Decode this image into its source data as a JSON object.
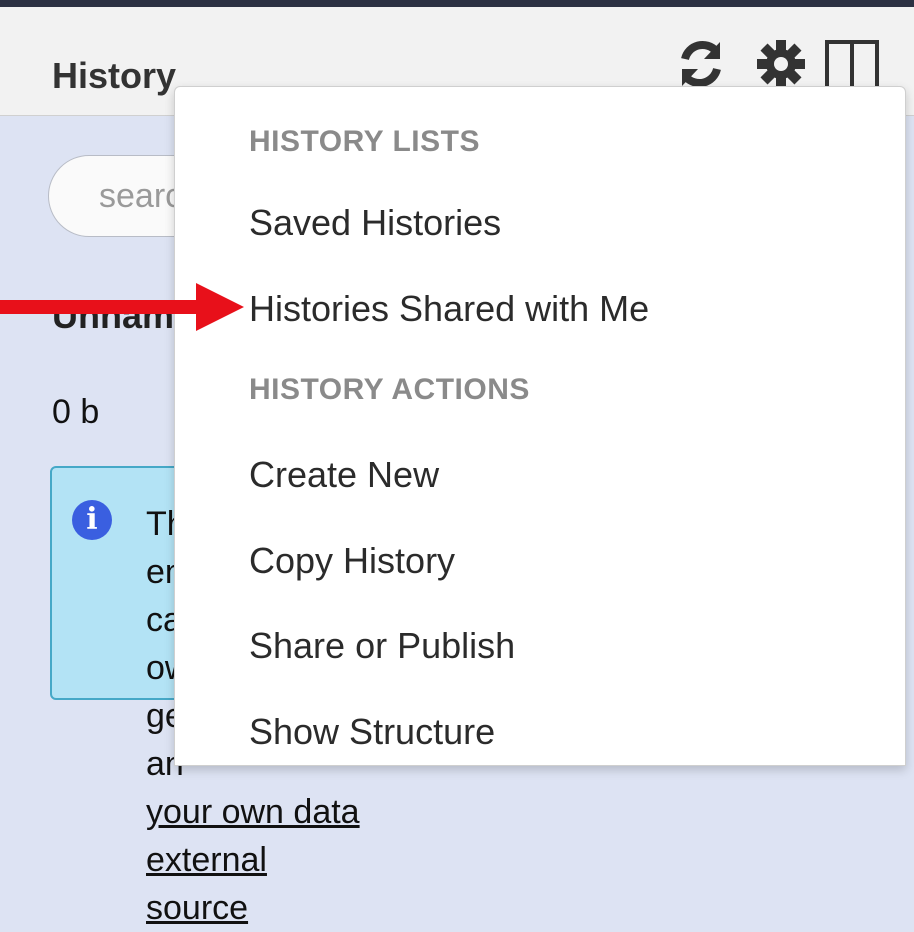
{
  "header": {
    "title": "History",
    "icons": [
      "refresh-icon",
      "gear-icon",
      "columns-icon"
    ]
  },
  "search": {
    "placeholder": "search datasets"
  },
  "history": {
    "name": "Unnamed history",
    "size": "0 b"
  },
  "info": {
    "icon": "info-icon",
    "text_line1": "This history is empty. You can load your own data or get data from an",
    "text_line2": "your own data",
    "text_line3": "external source"
  },
  "menu": {
    "lists_header": "HISTORY LISTS",
    "lists_items": [
      "Saved Histories",
      "Histories Shared with Me"
    ],
    "actions_header": "HISTORY ACTIONS",
    "actions_items": [
      "Create New",
      "Copy History",
      "Share or Publish",
      "Show Structure"
    ]
  },
  "colors": {
    "arrow": "#e8101a",
    "panel_bg": "#dde3f3",
    "info_bg": "#b3e3f5"
  }
}
